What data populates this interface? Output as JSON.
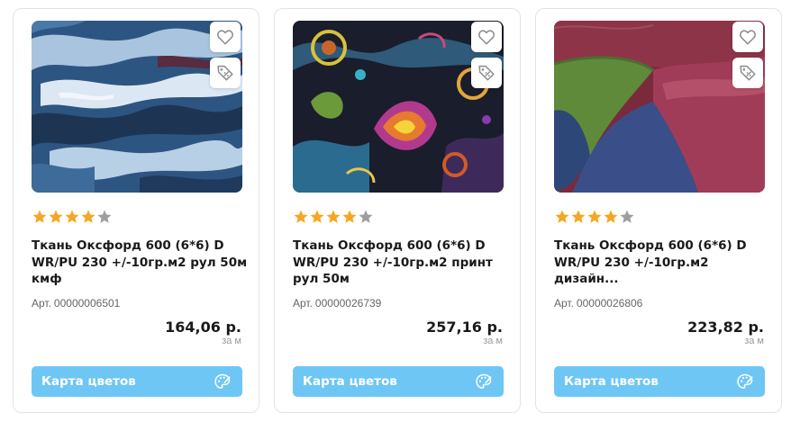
{
  "colors": {
    "accent_button": "#6ec6f5",
    "star_filled": "#f5a623",
    "star_empty": "#9e9e9e"
  },
  "products": [
    {
      "image": "blue-camouflage-fabric",
      "rating": 4,
      "rating_max": 5,
      "title": "Ткань Оксфорд 600 (6*6) D WR/PU 230 +/-10гр.м2 рул 50м кмф",
      "sku_label": "Арт.",
      "sku": "00000006501",
      "price": "164,06 р.",
      "unit": "за м",
      "button_label": "Карта цветов"
    },
    {
      "image": "paisley-print-fabric",
      "rating": 4,
      "rating_max": 5,
      "title": "Ткань Оксфорд 600 (6*6) D WR/PU 230 +/-10гр.м2 принт рул 50м",
      "sku_label": "Арт.",
      "sku": "00000026739",
      "price": "257,16 р.",
      "unit": "за м",
      "button_label": "Карта цветов"
    },
    {
      "image": "melange-colored-fabric",
      "rating": 4,
      "rating_max": 5,
      "title": "Ткань Оксфорд 600 (6*6) D WR/PU 230 +/-10гр.м2 дизайн...",
      "sku_label": "Арт.",
      "sku": "00000026806",
      "price": "223,82 р.",
      "unit": "за м",
      "button_label": "Карта цветов"
    }
  ]
}
